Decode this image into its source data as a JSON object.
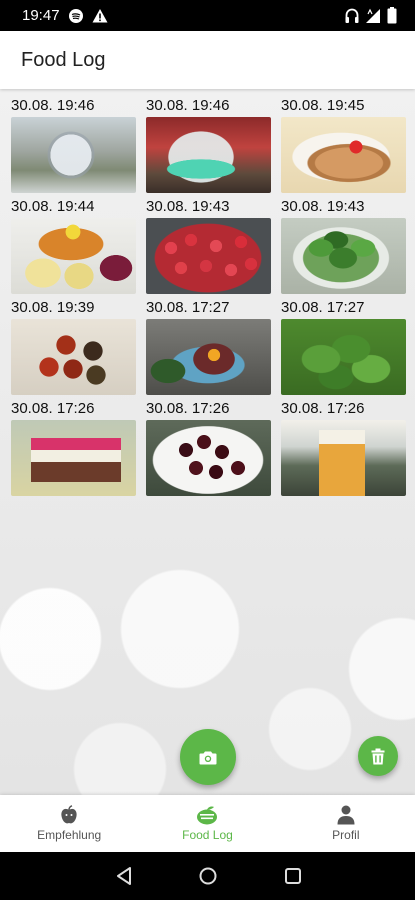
{
  "status": {
    "time": "19:47"
  },
  "app_bar": {
    "title": "Food Log"
  },
  "entries": [
    {
      "time": "30.08. 19:46",
      "photo": "crystal-glass"
    },
    {
      "time": "30.08. 19:46",
      "photo": "green-drink-glass"
    },
    {
      "time": "30.08. 19:45",
      "photo": "strudel-with-strawberry"
    },
    {
      "time": "30.08. 19:44",
      "photo": "schnitzel-potatoes"
    },
    {
      "time": "30.08. 19:43",
      "photo": "raspberries-bowl"
    },
    {
      "time": "30.08. 19:43",
      "photo": "green-salad"
    },
    {
      "time": "30.08. 19:39",
      "photo": "cherry-tomatoes"
    },
    {
      "time": "30.08. 17:27",
      "photo": "tartare-with-egg"
    },
    {
      "time": "30.08. 17:27",
      "photo": "lettuce-leaves"
    },
    {
      "time": "30.08. 17:26",
      "photo": "layer-cake-slice"
    },
    {
      "time": "30.08. 17:26",
      "photo": "cherries-plate"
    },
    {
      "time": "30.08. 17:26",
      "photo": "wheat-beer-glass"
    }
  ],
  "fab": {
    "primary_icon": "camera-icon",
    "secondary_icon": "trash-icon"
  },
  "nav": {
    "items": [
      {
        "label": "Empfehlung",
        "icon": "apple-icon"
      },
      {
        "label": "Food Log",
        "icon": "food-log-icon"
      },
      {
        "label": "Profil",
        "icon": "person-icon"
      }
    ],
    "active_index": 1
  },
  "colors": {
    "accent": "#5cb748",
    "background": "#ececec"
  }
}
